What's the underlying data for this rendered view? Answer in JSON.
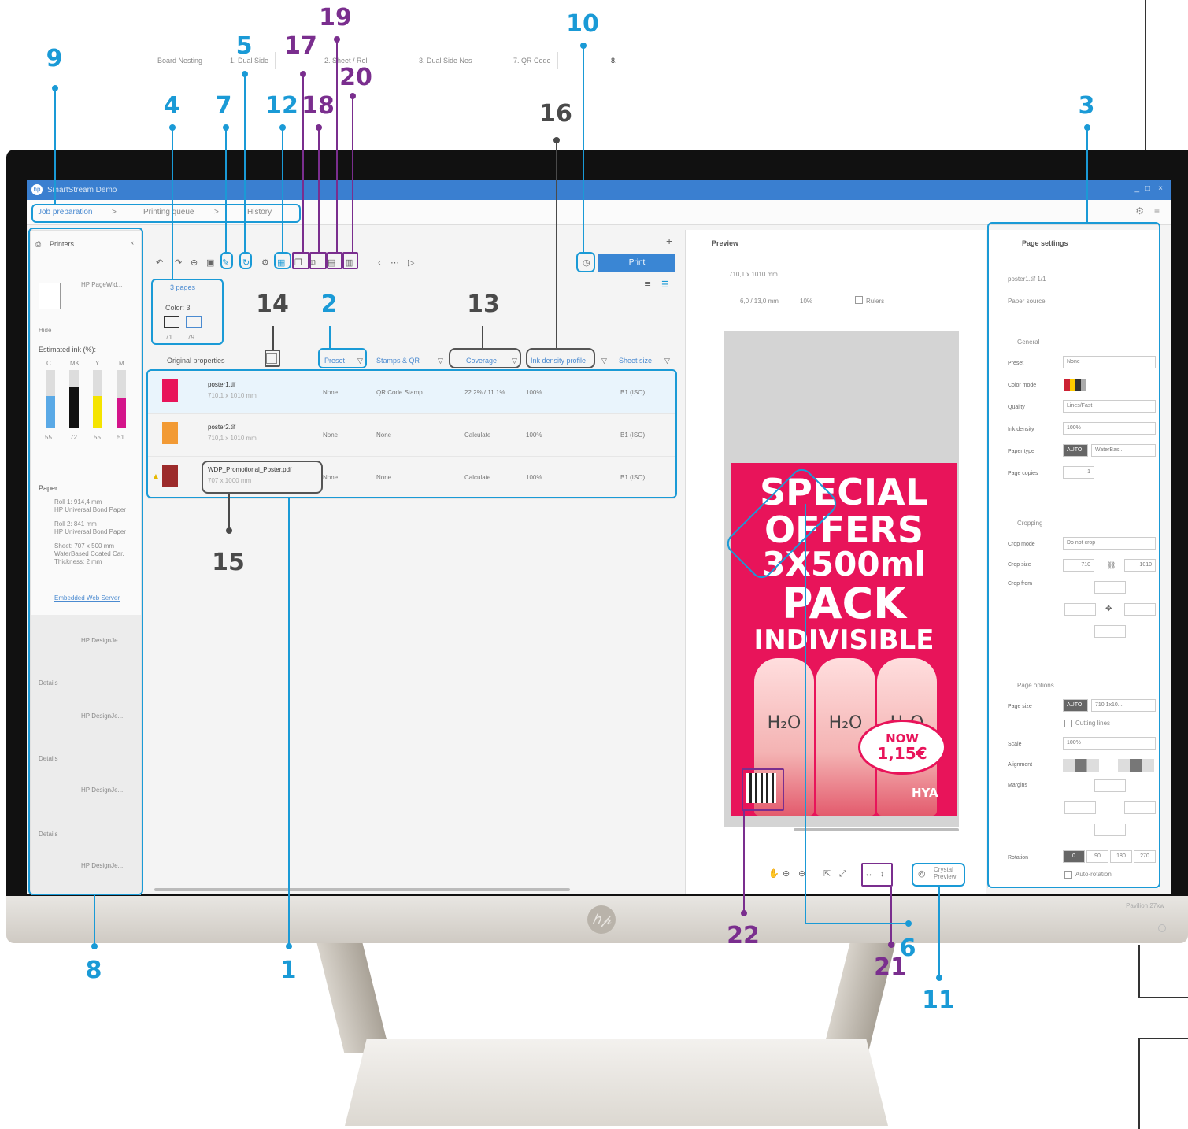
{
  "callouts": {
    "n1": "1",
    "n2": "2",
    "n3": "3",
    "n4": "4",
    "n5": "5",
    "n6": "6",
    "n7": "7",
    "n8": "8",
    "n9": "9",
    "n10": "10",
    "n11": "11",
    "n12": "12",
    "n13": "13",
    "n14": "14",
    "n15": "15",
    "n16": "16",
    "n17": "17",
    "n18": "18",
    "n19": "19",
    "n20": "20",
    "n21": "21",
    "n22": "22"
  },
  "app": {
    "title": "SmartStream Demo",
    "crumbs": [
      "Job preparation",
      "Printing queue",
      "History"
    ]
  },
  "printers": {
    "header": "Printers",
    "main_printer": "HP PageWid...",
    "hide_label": "Hide",
    "ink_title": "Estimated ink (%):",
    "ink_labels": [
      "C",
      "MK",
      "Y",
      "M"
    ],
    "ink_values": [
      "55",
      "72",
      "55",
      "51"
    ],
    "paper_title": "Paper:",
    "paper_items": [
      "Roll 1: 914,4 mm\nHP Universal Bond Paper",
      "Roll 2: 841 mm\nHP Universal Bond Paper",
      "Sheet: 707 x 500 mm\nWaterBased Coated Car.\nThickness: 2 mm"
    ],
    "ews_link": "Embedded Web Server",
    "others": [
      "HP DesignJe...",
      "HP DesignJe...",
      "HP DesignJe...",
      "HP DesignJe..."
    ],
    "details_label": "Details"
  },
  "tabs": [
    "Board Nesting",
    "1. Dual Side",
    "2. Sheet / Roll",
    "3. Dual Side Nes",
    "7. QR Code",
    "8."
  ],
  "toolbar": {
    "print_label": "Print"
  },
  "pages_panel": {
    "pages_label": "3 pages",
    "color_label": "Color: 3",
    "page_nums": [
      "71",
      "79"
    ]
  },
  "table": {
    "headers": [
      "Original properties",
      "Preset",
      "Stamps & QR",
      "Coverage",
      "Ink density profile",
      "Sheet size"
    ],
    "rows": [
      {
        "name": "poster1.tif",
        "size": "710,1 x 1010 mm",
        "preset": "None",
        "stamps": "QR Code Stamp",
        "coverage": "22.2% / 11.1%",
        "ink": "100%",
        "sheet": "B1 (ISO)"
      },
      {
        "name": "poster2.tif",
        "size": "710,1 x 1010 mm",
        "preset": "None",
        "stamps": "None",
        "coverage": "Calculate",
        "ink": "100%",
        "sheet": "B1 (ISO)"
      },
      {
        "name": "WDP_Promotional_Poster.pdf",
        "size": "707 x 1000 mm",
        "preset": "None",
        "stamps": "None",
        "coverage": "Calculate",
        "ink": "100%",
        "sheet": "B1 (ISO)"
      }
    ]
  },
  "preview": {
    "title": "Preview",
    "file_label": "710,1 x 1010 mm",
    "size_info": "6,0 / 13,0 mm",
    "zoom": "10%",
    "rulers_label": "Rulers",
    "crystal_label": "Crystal Preview"
  },
  "poster": {
    "line1": "SPECIAL",
    "line2": "OFFERS",
    "line3": "3X500ml",
    "line4": "PACK",
    "line5": "INDIVISIBLE",
    "bottle_label": "H₂O",
    "badge1": "NOW",
    "badge2": "1,15€",
    "brand": "HYA"
  },
  "settings": {
    "title": "Page settings",
    "file": "poster1.tif  1/1",
    "paper_source": "Paper source",
    "general": "General",
    "rows": [
      {
        "label": "Preset",
        "value": "None"
      },
      {
        "label": "Color mode",
        "value": ""
      },
      {
        "label": "Quality",
        "value": "Lines/Fast"
      },
      {
        "label": "Ink density",
        "value": "100%"
      },
      {
        "label": "Paper type",
        "value": "WaterBas..."
      },
      {
        "label": "Page copies",
        "value": "1"
      }
    ],
    "cropping": "Cropping",
    "crop_mode": "Crop mode",
    "crop_mode_value": "Do not crop",
    "crop_size": "Crop size",
    "crop_from": "Crop from",
    "crop_w": "710",
    "crop_h": "1010",
    "page_options": "Page options",
    "page_size": "Page size",
    "page_size_value": "710,1x10...",
    "cutting_lines": "Cutting lines",
    "scale": "Scale",
    "scale_value": "100%",
    "alignment": "Alignment",
    "margins": "Margins",
    "rotation": "Rotation",
    "rotations": [
      "0",
      "90",
      "180",
      "270"
    ],
    "auto_rotation": "Auto-rotation",
    "auto": "AUTO"
  },
  "monitor": {
    "model": "Pavilion 27xw"
  }
}
